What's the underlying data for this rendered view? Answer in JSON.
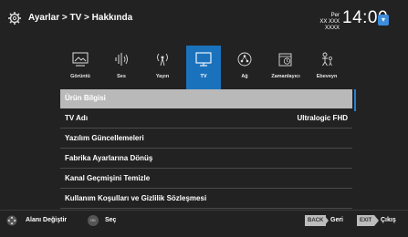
{
  "header": {
    "breadcrumb": "Ayarlar > TV > Hakkında",
    "day": "Per",
    "date": "XX XXX XXXX",
    "time": "14:00"
  },
  "tabs": [
    {
      "label": "Görüntü",
      "icon": "picture-icon"
    },
    {
      "label": "Ses",
      "icon": "sound-icon"
    },
    {
      "label": "Yayın",
      "icon": "broadcast-icon"
    },
    {
      "label": "TV",
      "icon": "tv-icon"
    },
    {
      "label": "Ağ",
      "icon": "network-icon"
    },
    {
      "label": "Zamanlayıcı",
      "icon": "timer-icon"
    },
    {
      "label": "Ebeveyn",
      "icon": "parental-icon"
    }
  ],
  "active_tab": "TV",
  "menu": [
    {
      "label": "Ürün Bilgisi",
      "value": ""
    },
    {
      "label": "TV Adı",
      "value": "Ultralogic FHD"
    },
    {
      "label": "Yazılım Güncellemeleri",
      "value": ""
    },
    {
      "label": "Fabrika Ayarlarına Dönüş",
      "value": ""
    },
    {
      "label": "Kanal Geçmişini Temizle",
      "value": ""
    },
    {
      "label": "Kullanım Koşulları ve Gizlilik Sözleşmesi",
      "value": ""
    }
  ],
  "footer": {
    "move_label": "Alanı Değiştir",
    "ok_key": "OK",
    "select_label": "Seç",
    "back_key": "BACK",
    "back_label": "Geri",
    "exit_key": "EXIT",
    "exit_label": "Çıkış"
  },
  "colors": {
    "background": "#222222",
    "accent": "#1a72bd",
    "highlight_row": "#b9b9b9"
  }
}
